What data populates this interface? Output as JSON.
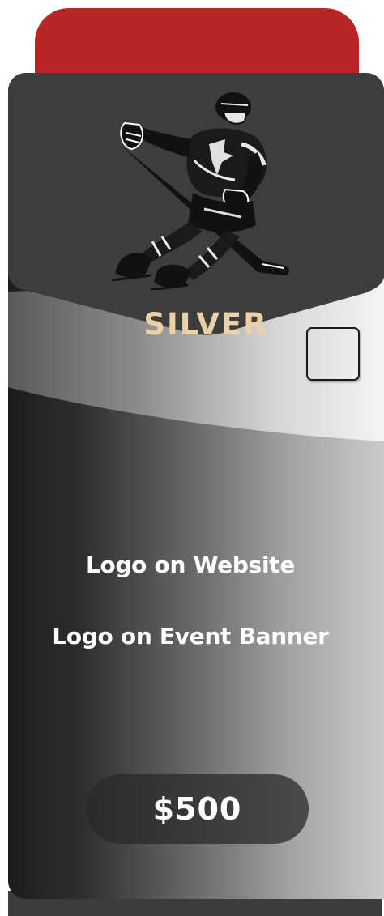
{
  "tier": {
    "name": "SILVER",
    "name_color": "#ecd0a6",
    "accent_color": "#b72625",
    "illustration": "hockey-player-icon"
  },
  "benefits": [
    {
      "label": "Logo on Website"
    },
    {
      "label": "Logo on Event Banner"
    }
  ],
  "price": {
    "label": "$500"
  },
  "checkbox": {
    "checked": false
  }
}
